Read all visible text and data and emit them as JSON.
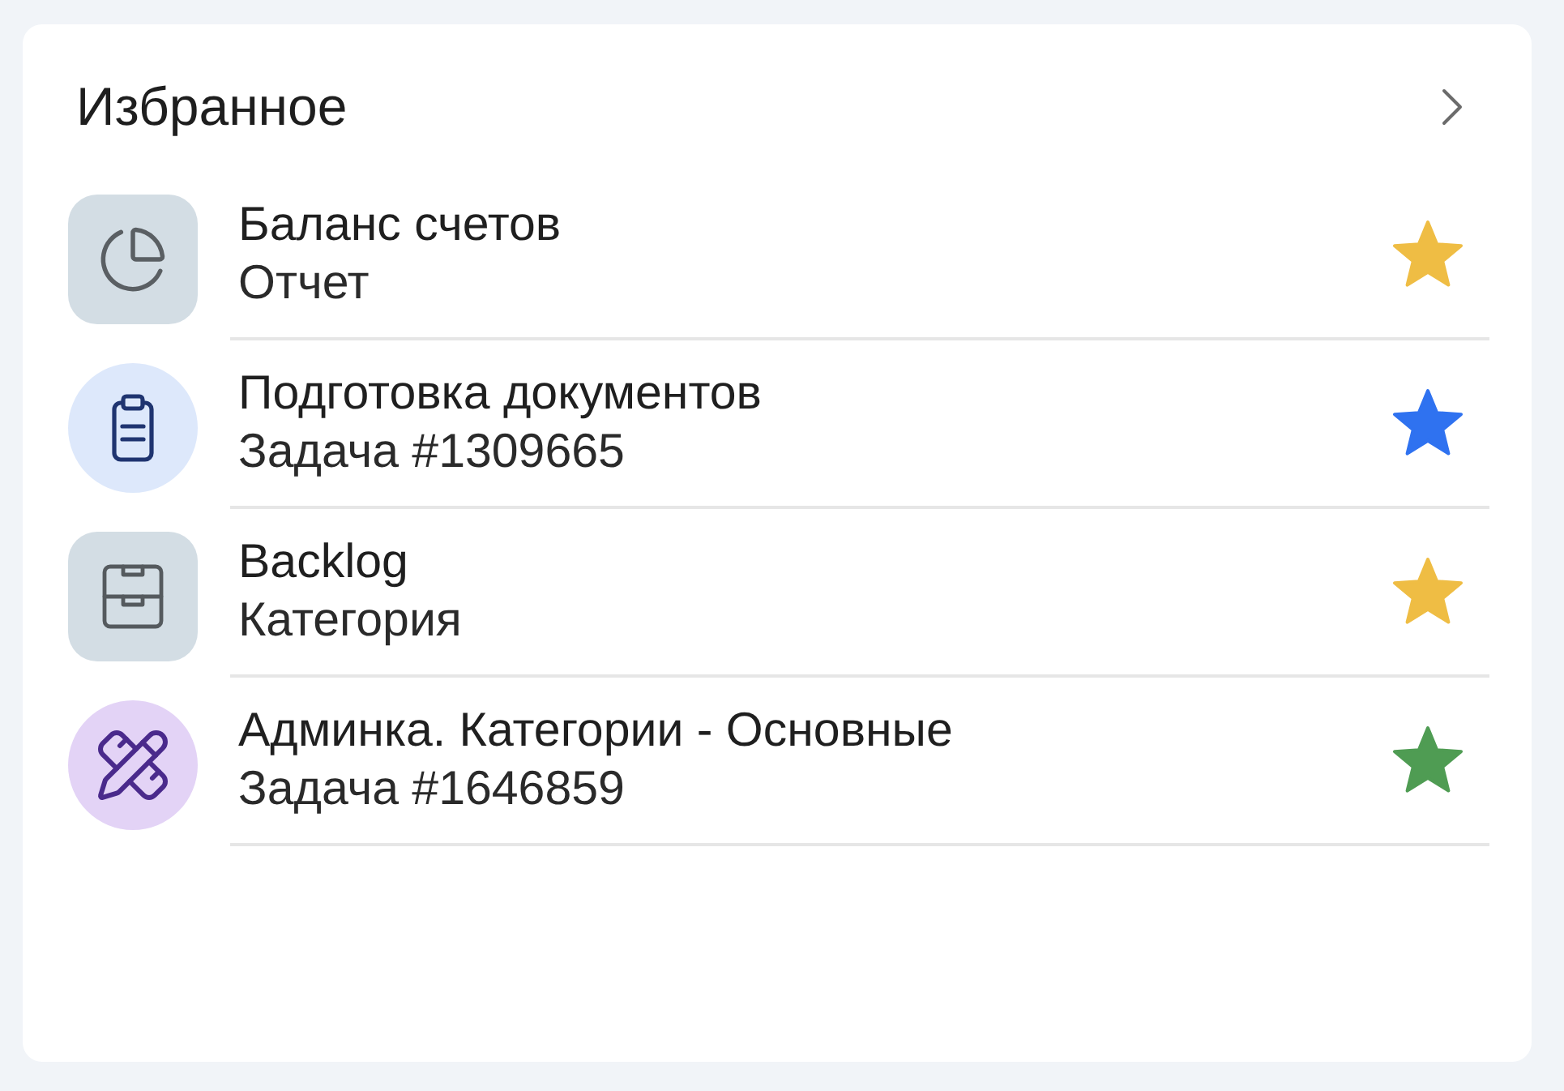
{
  "header": {
    "title": "Избранное"
  },
  "items": [
    {
      "title": "Баланс счетов",
      "subtitle": "Отчет",
      "tile": {
        "kind": "square",
        "color": "#d3dde4"
      },
      "color": "#efbd44"
    },
    {
      "title": "Подготовка документов",
      "subtitle": "Задача #1309665",
      "tile": {
        "kind": "circle",
        "color": "#dde8fb"
      },
      "color": "#2f72f0"
    },
    {
      "title": "Backlog",
      "subtitle": "Категория",
      "tile": {
        "kind": "square",
        "color": "#d3dde4"
      },
      "color": "#efbd44"
    },
    {
      "title": "Админка. Категории - Основные",
      "subtitle": "Задача #1646859",
      "tile": {
        "kind": "circle",
        "color": "#e3d3f6"
      },
      "color": "#4f9c53"
    }
  ]
}
